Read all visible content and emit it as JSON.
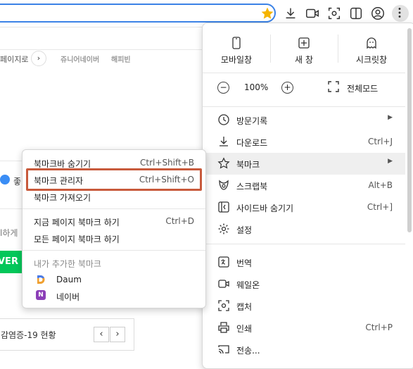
{
  "page": {
    "nav_text": "페이지로",
    "nav_link1": "쥬니어네이버",
    "nav_link2": "해피빈",
    "frag_like": "좋",
    "frag_search": "l하게",
    "naver_banner": "VER",
    "covid_title": "감염증-19 현황",
    "prev_label": "‹",
    "next_label": "›"
  },
  "menu": {
    "top": [
      {
        "label": "모바일창",
        "icon": "mobile-icon"
      },
      {
        "label": "새 창",
        "icon": "new-window-icon"
      },
      {
        "label": "시크릿창",
        "icon": "secret-icon"
      }
    ],
    "zoom": {
      "minus": "−",
      "value": "100%",
      "plus": "+",
      "fullscreen": "전체모드"
    },
    "items": [
      {
        "label": "방문기록",
        "shortcut": "",
        "arrow": "▶",
        "icon": "history-icon"
      },
      {
        "label": "다운로드",
        "shortcut": "Ctrl+J",
        "arrow": "",
        "icon": "download-icon"
      },
      {
        "label": "북마크",
        "shortcut": "",
        "arrow": "▶",
        "icon": "star-icon"
      },
      {
        "label": "스크랩북",
        "shortcut": "Alt+B",
        "arrow": "",
        "icon": "scrapbook-icon"
      },
      {
        "label": "사이드바 숨기기",
        "shortcut": "Ctrl+]",
        "arrow": "",
        "icon": "sidebar-icon"
      },
      {
        "label": "설정",
        "shortcut": "",
        "arrow": "",
        "icon": "gear-icon"
      },
      {
        "label": "번역",
        "shortcut": "",
        "arrow": "",
        "icon": "translate-icon"
      },
      {
        "label": "웨일온",
        "shortcut": "",
        "arrow": "",
        "icon": "video-icon"
      },
      {
        "label": "캡처",
        "shortcut": "",
        "arrow": "",
        "icon": "capture-icon"
      },
      {
        "label": "인쇄",
        "shortcut": "Ctrl+P",
        "arrow": "",
        "icon": "print-icon"
      },
      {
        "label": "전송...",
        "shortcut": "",
        "arrow": "",
        "icon": "cast-icon"
      }
    ]
  },
  "submenu": {
    "items": [
      {
        "label": "북마크바 숨기기",
        "shortcut": "Ctrl+Shift+B"
      },
      {
        "label": "북마크 관리자",
        "shortcut": "Ctrl+Shift+O"
      },
      {
        "label": "북마크 가져오기",
        "shortcut": ""
      },
      {
        "label": "지금 페이지 북마크 하기",
        "shortcut": "Ctrl+D"
      },
      {
        "label": "모든 페이지 북마크 하기",
        "shortcut": ""
      }
    ],
    "section_header": "내가 추가한 북마크",
    "bookmarks": [
      {
        "label": "Daum",
        "color": "#4a7be8"
      },
      {
        "label": "네이버",
        "color": "#8c3fb8"
      }
    ],
    "naver_letter": "N"
  },
  "colors": {
    "accent": "#3b82e6",
    "star": "#f5b400",
    "highlight": "#c85a3c",
    "naver_green": "#03c75a"
  }
}
